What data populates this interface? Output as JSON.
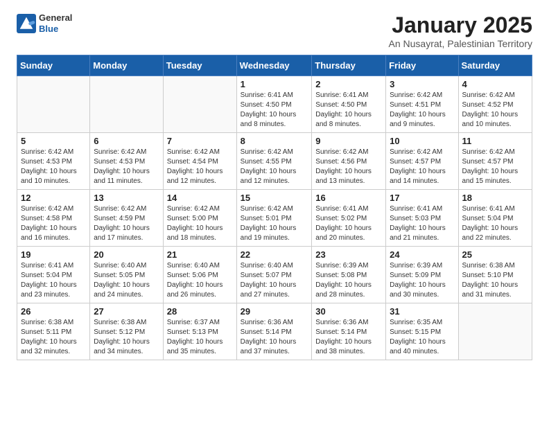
{
  "header": {
    "logo_general": "General",
    "logo_blue": "Blue",
    "month_title": "January 2025",
    "location": "An Nusayrat, Palestinian Territory"
  },
  "weekdays": [
    "Sunday",
    "Monday",
    "Tuesday",
    "Wednesday",
    "Thursday",
    "Friday",
    "Saturday"
  ],
  "weeks": [
    [
      {
        "day": "",
        "detail": ""
      },
      {
        "day": "",
        "detail": ""
      },
      {
        "day": "",
        "detail": ""
      },
      {
        "day": "1",
        "detail": "Sunrise: 6:41 AM\nSunset: 4:50 PM\nDaylight: 10 hours and 8 minutes."
      },
      {
        "day": "2",
        "detail": "Sunrise: 6:41 AM\nSunset: 4:50 PM\nDaylight: 10 hours and 8 minutes."
      },
      {
        "day": "3",
        "detail": "Sunrise: 6:42 AM\nSunset: 4:51 PM\nDaylight: 10 hours and 9 minutes."
      },
      {
        "day": "4",
        "detail": "Sunrise: 6:42 AM\nSunset: 4:52 PM\nDaylight: 10 hours and 10 minutes."
      }
    ],
    [
      {
        "day": "5",
        "detail": "Sunrise: 6:42 AM\nSunset: 4:53 PM\nDaylight: 10 hours and 10 minutes."
      },
      {
        "day": "6",
        "detail": "Sunrise: 6:42 AM\nSunset: 4:53 PM\nDaylight: 10 hours and 11 minutes."
      },
      {
        "day": "7",
        "detail": "Sunrise: 6:42 AM\nSunset: 4:54 PM\nDaylight: 10 hours and 12 minutes."
      },
      {
        "day": "8",
        "detail": "Sunrise: 6:42 AM\nSunset: 4:55 PM\nDaylight: 10 hours and 12 minutes."
      },
      {
        "day": "9",
        "detail": "Sunrise: 6:42 AM\nSunset: 4:56 PM\nDaylight: 10 hours and 13 minutes."
      },
      {
        "day": "10",
        "detail": "Sunrise: 6:42 AM\nSunset: 4:57 PM\nDaylight: 10 hours and 14 minutes."
      },
      {
        "day": "11",
        "detail": "Sunrise: 6:42 AM\nSunset: 4:57 PM\nDaylight: 10 hours and 15 minutes."
      }
    ],
    [
      {
        "day": "12",
        "detail": "Sunrise: 6:42 AM\nSunset: 4:58 PM\nDaylight: 10 hours and 16 minutes."
      },
      {
        "day": "13",
        "detail": "Sunrise: 6:42 AM\nSunset: 4:59 PM\nDaylight: 10 hours and 17 minutes."
      },
      {
        "day": "14",
        "detail": "Sunrise: 6:42 AM\nSunset: 5:00 PM\nDaylight: 10 hours and 18 minutes."
      },
      {
        "day": "15",
        "detail": "Sunrise: 6:42 AM\nSunset: 5:01 PM\nDaylight: 10 hours and 19 minutes."
      },
      {
        "day": "16",
        "detail": "Sunrise: 6:41 AM\nSunset: 5:02 PM\nDaylight: 10 hours and 20 minutes."
      },
      {
        "day": "17",
        "detail": "Sunrise: 6:41 AM\nSunset: 5:03 PM\nDaylight: 10 hours and 21 minutes."
      },
      {
        "day": "18",
        "detail": "Sunrise: 6:41 AM\nSunset: 5:04 PM\nDaylight: 10 hours and 22 minutes."
      }
    ],
    [
      {
        "day": "19",
        "detail": "Sunrise: 6:41 AM\nSunset: 5:04 PM\nDaylight: 10 hours and 23 minutes."
      },
      {
        "day": "20",
        "detail": "Sunrise: 6:40 AM\nSunset: 5:05 PM\nDaylight: 10 hours and 24 minutes."
      },
      {
        "day": "21",
        "detail": "Sunrise: 6:40 AM\nSunset: 5:06 PM\nDaylight: 10 hours and 26 minutes."
      },
      {
        "day": "22",
        "detail": "Sunrise: 6:40 AM\nSunset: 5:07 PM\nDaylight: 10 hours and 27 minutes."
      },
      {
        "day": "23",
        "detail": "Sunrise: 6:39 AM\nSunset: 5:08 PM\nDaylight: 10 hours and 28 minutes."
      },
      {
        "day": "24",
        "detail": "Sunrise: 6:39 AM\nSunset: 5:09 PM\nDaylight: 10 hours and 30 minutes."
      },
      {
        "day": "25",
        "detail": "Sunrise: 6:38 AM\nSunset: 5:10 PM\nDaylight: 10 hours and 31 minutes."
      }
    ],
    [
      {
        "day": "26",
        "detail": "Sunrise: 6:38 AM\nSunset: 5:11 PM\nDaylight: 10 hours and 32 minutes."
      },
      {
        "day": "27",
        "detail": "Sunrise: 6:38 AM\nSunset: 5:12 PM\nDaylight: 10 hours and 34 minutes."
      },
      {
        "day": "28",
        "detail": "Sunrise: 6:37 AM\nSunset: 5:13 PM\nDaylight: 10 hours and 35 minutes."
      },
      {
        "day": "29",
        "detail": "Sunrise: 6:36 AM\nSunset: 5:14 PM\nDaylight: 10 hours and 37 minutes."
      },
      {
        "day": "30",
        "detail": "Sunrise: 6:36 AM\nSunset: 5:14 PM\nDaylight: 10 hours and 38 minutes."
      },
      {
        "day": "31",
        "detail": "Sunrise: 6:35 AM\nSunset: 5:15 PM\nDaylight: 10 hours and 40 minutes."
      },
      {
        "day": "",
        "detail": ""
      }
    ]
  ]
}
